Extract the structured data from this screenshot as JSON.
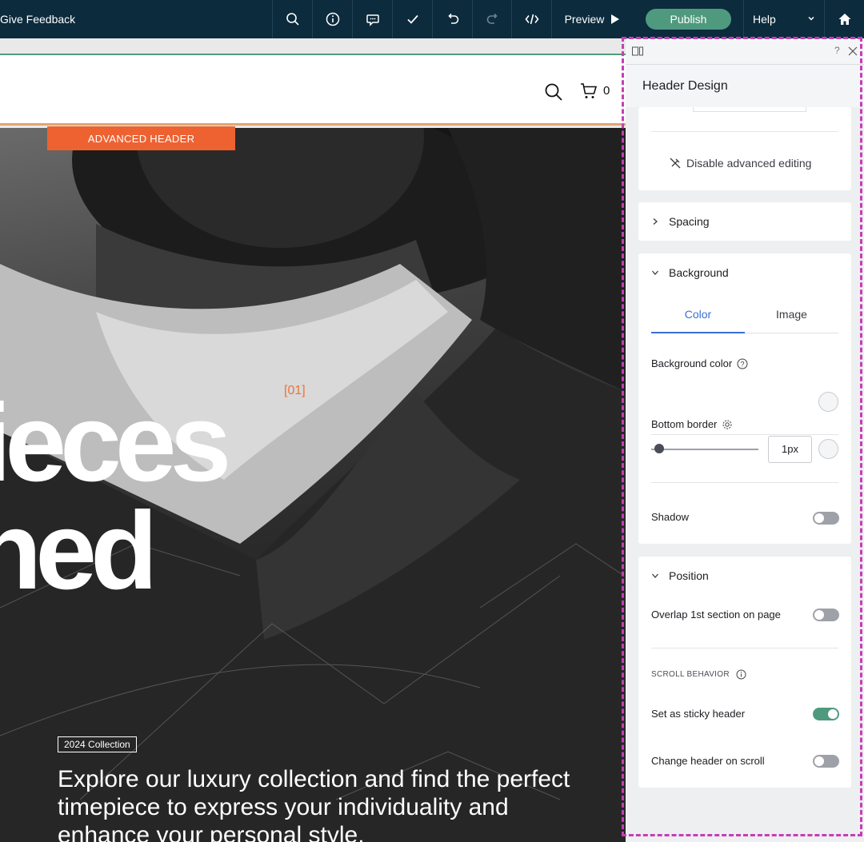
{
  "topbar": {
    "feedback_label": "Give Feedback",
    "preview_label": "Preview",
    "publish_label": "Publish",
    "help_label": "Help",
    "icons": [
      "search-icon",
      "info-icon",
      "comment-icon",
      "checkmark-icon",
      "undo-icon",
      "redo-icon",
      "code-icon",
      "play-icon",
      "chevron-down-icon",
      "home-icon"
    ]
  },
  "site_header": {
    "cart_count": "0"
  },
  "hero": {
    "advanced_header_label": "ADVANCED HEADER",
    "index_label": "[01]",
    "headline_line1": "ieces",
    "headline_line2": "hed",
    "collection_badge": "2024 Collection",
    "body_text": "Explore our luxury collection and find the perfect timepiece to express your individuality and enhance your personal style."
  },
  "panel": {
    "title": "Header Design",
    "help_label": "?",
    "disable_label": "Disable advanced editing",
    "spacing": {
      "title": "Spacing"
    },
    "background": {
      "title": "Background",
      "tab_color": "Color",
      "tab_image": "Image",
      "bg_color_label": "Background color",
      "bottom_border_label": "Bottom border",
      "border_value": "1px",
      "shadow_label": "Shadow",
      "shadow_on": false
    },
    "position": {
      "title": "Position",
      "overlap_label": "Overlap 1st section on page",
      "overlap_on": false,
      "scroll_caption": "SCROLL BEHAVIOR",
      "sticky_label": "Set as sticky header",
      "sticky_on": true,
      "change_label": "Change header on scroll",
      "change_on": false
    }
  },
  "colors": {
    "topbar_bg": "#0c2b3d",
    "publish_bg": "#4f9a7e",
    "accent_orange": "#ee6232",
    "tab_blue": "#3b6fd4",
    "selection_outline": "#c43fb5"
  }
}
